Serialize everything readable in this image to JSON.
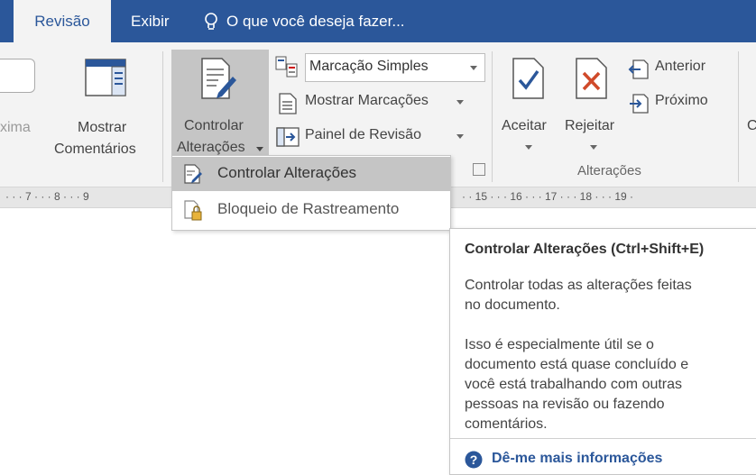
{
  "tabs": {
    "revisao": "Revisão",
    "exibir": "Exibir",
    "tell_me": "O que você deseja fazer..."
  },
  "ribbon": {
    "proxima_partial": "xima",
    "mostrar_comentarios": [
      "Mostrar",
      "Comentários"
    ],
    "controlar_alteracoes": [
      "Controlar",
      "Alterações"
    ],
    "markup_select_value": "Marcação Simples",
    "mostrar_marcacoes": "Mostrar Marcações",
    "painel_revisao": "Painel de Revisão",
    "aceitar": "Aceitar",
    "rejeitar": "Rejeitar",
    "anterior": "Anterior",
    "proximo": "Próximo",
    "group_alteracoes": "Alterações",
    "partial_right": "C"
  },
  "ruler": {
    "left_text": "· · · 7 · · · 8 · · · 9",
    "right_text": "· · 15 · · · 16 · · · 17 · · · 18 · · · 19 ·"
  },
  "dropdown": {
    "items": [
      {
        "label": "Controlar Alterações",
        "icon": "track-changes-icon",
        "highlighted": true
      },
      {
        "label": "Bloqueio de Rastreamento",
        "icon": "lock-tracking-icon",
        "highlighted": false
      }
    ]
  },
  "tooltip": {
    "title": "Controlar Alterações (Ctrl+Shift+E)",
    "para1": "Controlar todas as alterações feitas\nno documento.",
    "para2": "Isso é especialmente útil se o\ndocumento está quase concluído e\nvocê está trabalhando com outras\npessoas na revisão ou fazendo\ncomentários.",
    "more_info": "Dê-me mais informações"
  },
  "colors": {
    "tab_bar": "#2b579a",
    "ribbon_bg": "#f3f3f3",
    "highlight": "#c5c5c5",
    "link": "#2b579a"
  }
}
